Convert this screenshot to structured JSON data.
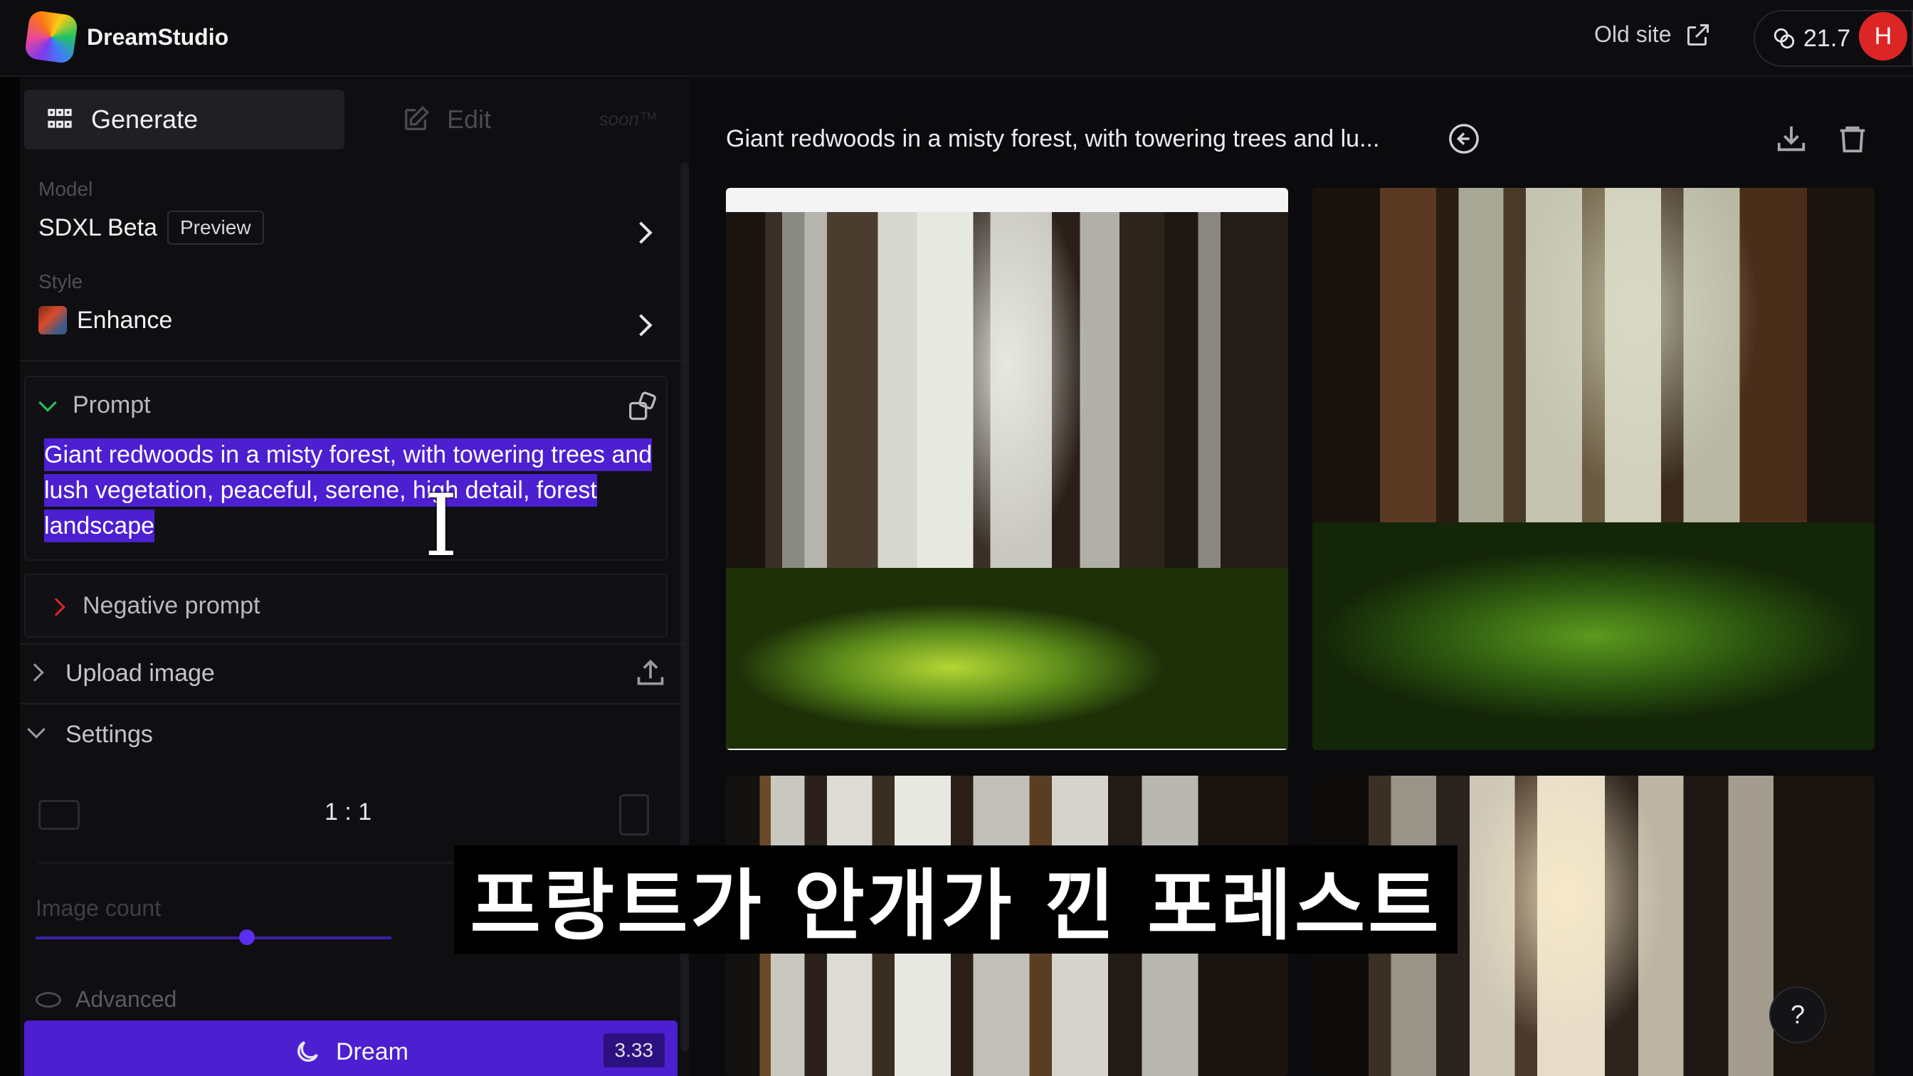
{
  "app": {
    "name": "DreamStudio"
  },
  "header": {
    "old_site_label": "Old site",
    "credits": "21.7",
    "avatar_initial": "H"
  },
  "sidebar": {
    "tabs": [
      {
        "label": "Generate",
        "active": true
      },
      {
        "label": "Edit",
        "active": false,
        "tag": "soon™"
      }
    ],
    "model": {
      "label": "Model",
      "value": "SDXL Beta",
      "badge": "Preview"
    },
    "style": {
      "label": "Style",
      "value": "Enhance"
    },
    "prompt": {
      "label": "Prompt",
      "text": "Giant redwoods in a misty forest, with towering trees and lush vegetation, peaceful, serene, high detail, forest landscape"
    },
    "negative_prompt": {
      "label": "Negative prompt"
    },
    "upload_image": {
      "label": "Upload image"
    },
    "settings": {
      "label": "Settings"
    },
    "aspect_ratio": {
      "value": "1 : 1"
    },
    "image_count": {
      "label": "Image count"
    },
    "advanced": {
      "label": "Advanced"
    },
    "dream": {
      "label": "Dream",
      "cost": "3.33"
    }
  },
  "main": {
    "title": "Giant redwoods in a misty forest, with towering trees and lu..."
  },
  "overlay": {
    "subtitle": "프랑트가 안개가 낀 포레스트"
  },
  "help": {
    "label": "?"
  },
  "colors": {
    "accent": "#4c1fd1",
    "avatar": "#dc2626",
    "selection": "#4c1fd1"
  }
}
